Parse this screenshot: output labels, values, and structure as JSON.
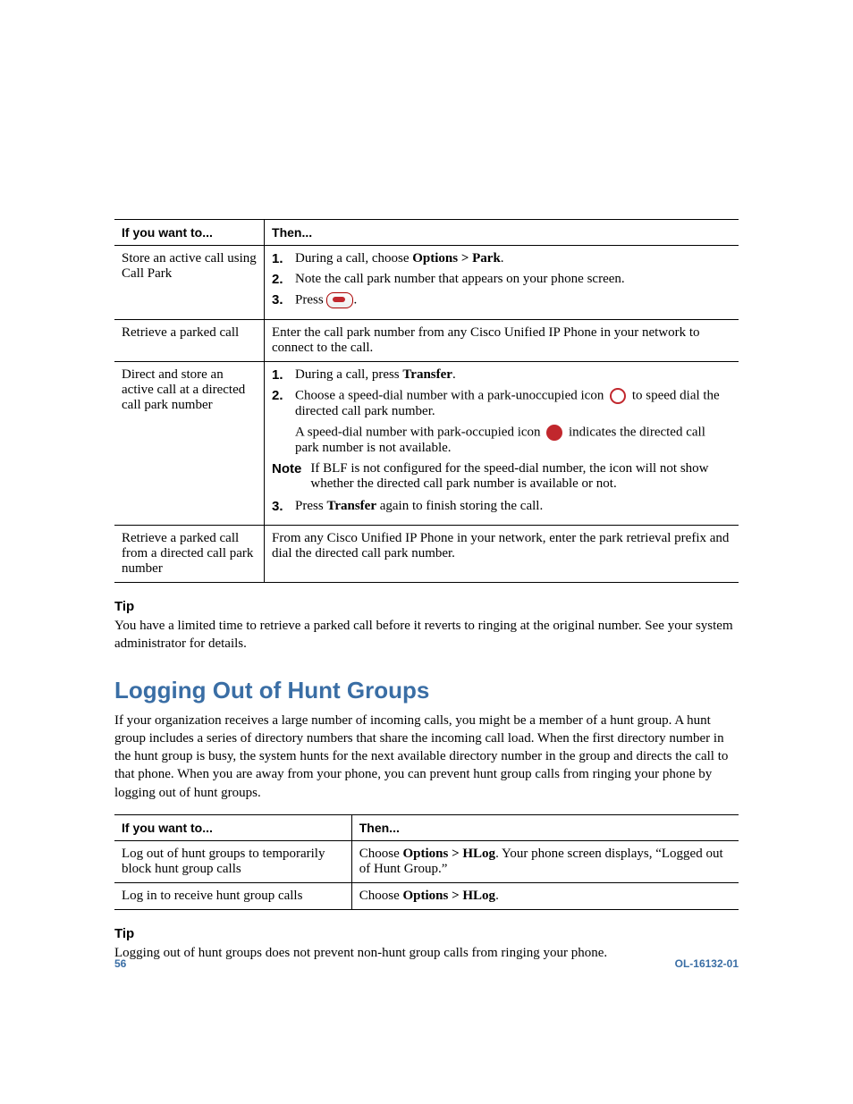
{
  "table1": {
    "headers": [
      "If you want to...",
      "Then..."
    ],
    "rows": [
      {
        "want": "Store an active call using Call Park",
        "steps": {
          "s1_pre": "During a call, choose ",
          "s1_bold": "Options > Park",
          "s1_post": ".",
          "s2": "Note the call park number that appears on your phone screen.",
          "s3_pre": "Press ",
          "s3_post": "."
        }
      },
      {
        "want": "Retrieve a parked call",
        "then": "Enter the call park number from any Cisco Unified IP Phone in your network to connect to the call."
      },
      {
        "want": "Direct and store an active call at a directed call park number",
        "steps": {
          "s1_pre": "During a call, press ",
          "s1_bold": "Transfer",
          "s1_post": ".",
          "s2_pre": "Choose a speed-dial number with a park-unoccupied icon ",
          "s2_post": " to speed dial the directed call park number.",
          "indent_pre": "A speed-dial number with park-occupied icon ",
          "indent_post": " indicates the directed call park number is not available.",
          "note_label": "Note",
          "note_text": "If BLF is not configured for the speed-dial number, the icon will not show whether the directed call park number is available or not.",
          "s3_pre": "Press ",
          "s3_bold": "Transfer",
          "s3_post": " again to finish storing the call."
        }
      },
      {
        "want": "Retrieve a parked call from a directed call park number",
        "then": "From any Cisco Unified IP Phone in your network, enter the park retrieval prefix and dial the directed call park number."
      }
    ]
  },
  "tip1": {
    "head": "Tip",
    "text": "You have a limited time to retrieve a parked call before it reverts to ringing at the original number. See your system administrator for details."
  },
  "section_title": "Logging Out of Hunt Groups",
  "section_intro": "If your organization receives a large number of incoming calls, you might be a member of a hunt group. A hunt group includes a series of directory numbers that share the incoming call load. When the first directory number in the hunt group is busy, the system hunts for the next available directory number in the group and directs the call to that phone. When you are away from your phone, you can prevent hunt group calls from ringing your phone by logging out of hunt groups.",
  "table2": {
    "headers": [
      "If you want to...",
      "Then..."
    ],
    "rows": [
      {
        "want": "Log out of hunt groups to temporarily block hunt group calls",
        "then_pre": "Choose ",
        "then_bold": "Options > HLog",
        "then_post": ". Your phone screen displays, “Logged out of Hunt Group.”"
      },
      {
        "want": "Log in to receive hunt group calls",
        "then_pre": "Choose ",
        "then_bold": "Options > HLog",
        "then_post": "."
      }
    ]
  },
  "tip2": {
    "head": "Tip",
    "text": "Logging out of hunt groups does not prevent non-hunt group calls from ringing your phone."
  },
  "footer": {
    "page": "56",
    "docid": "OL-16132-01"
  }
}
